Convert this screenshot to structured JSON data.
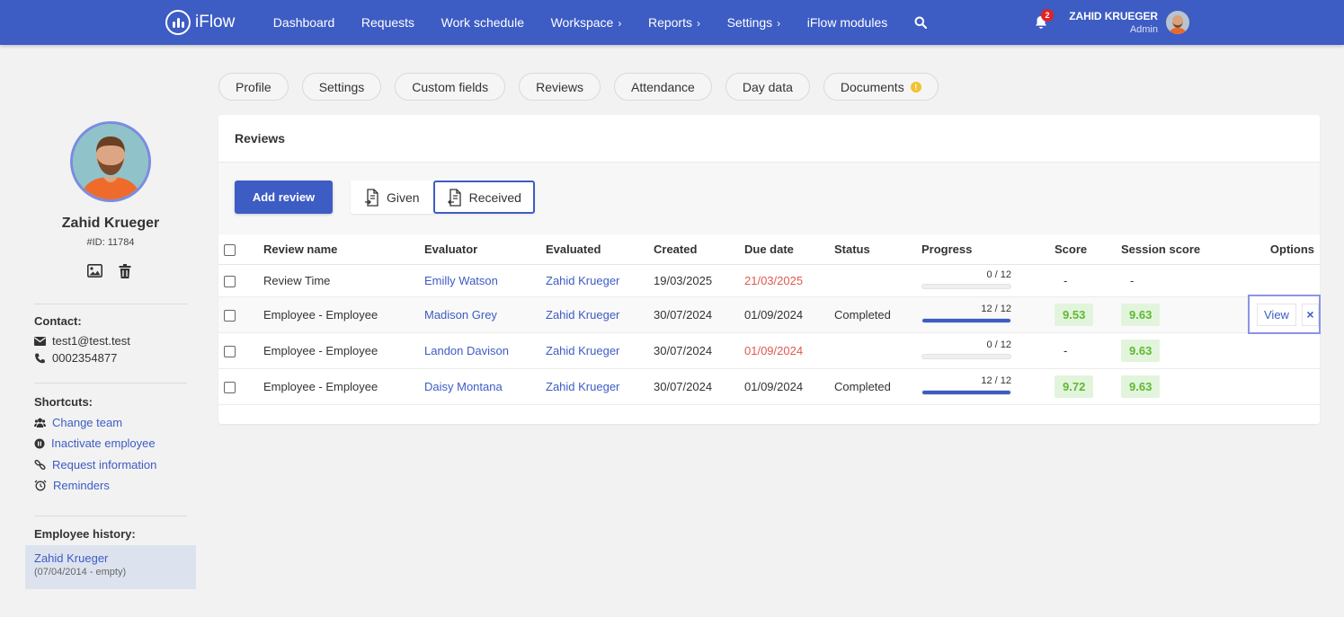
{
  "brand": {
    "name": "iFlow"
  },
  "nav": {
    "items": [
      {
        "label": "Dashboard",
        "has_submenu": false
      },
      {
        "label": "Requests",
        "has_submenu": false
      },
      {
        "label": "Work schedule",
        "has_submenu": false
      },
      {
        "label": "Workspace",
        "has_submenu": true
      },
      {
        "label": "Reports",
        "has_submenu": true
      },
      {
        "label": "Settings",
        "has_submenu": true
      },
      {
        "label": "iFlow modules",
        "has_submenu": false
      }
    ],
    "chevron": "›"
  },
  "user": {
    "name": "ZAHID KRUEGER",
    "role": "Admin",
    "notifications": "2"
  },
  "employee": {
    "name": "Zahid Krueger",
    "id": "#ID: 11784",
    "contact_title": "Contact:",
    "email": "test1@test.test",
    "phone": "0002354877",
    "shortcuts_title": "Shortcuts:",
    "shortcuts": [
      "Change team",
      "Inactivate employee",
      "Request information",
      "Reminders"
    ],
    "history_title": "Employee history:",
    "history": {
      "name": "Zahid Krueger",
      "range": "(07/04/2014 - empty)"
    }
  },
  "tabs": [
    {
      "label": "Profile",
      "warning": false
    },
    {
      "label": "Settings",
      "warning": false
    },
    {
      "label": "Custom fields",
      "warning": false
    },
    {
      "label": "Reviews",
      "warning": false
    },
    {
      "label": "Attendance",
      "warning": false
    },
    {
      "label": "Day data",
      "warning": false
    },
    {
      "label": "Documents",
      "warning": true
    }
  ],
  "reviews": {
    "title": "Reviews",
    "add_label": "Add review",
    "given_label": "Given",
    "received_label": "Received",
    "active_toggle": "Received",
    "columns": [
      "Review name",
      "Evaluator",
      "Evaluated",
      "Created",
      "Due date",
      "Status",
      "Progress",
      "Score",
      "Session score",
      "Options"
    ],
    "rows": [
      {
        "name": "Review Time",
        "evaluator": "Emilly Watson",
        "evaluated": "Zahid Krueger",
        "created": "19/03/2025",
        "due": "21/03/2025",
        "due_overdue": true,
        "status": "",
        "progress_label": "0 / 12",
        "progress": 0,
        "score": "-",
        "session_score": "-"
      },
      {
        "name": "Employee - Employee",
        "evaluator": "Madison Grey",
        "evaluated": "Zahid Krueger",
        "created": "30/07/2024",
        "due": "01/09/2024",
        "due_overdue": false,
        "status": "Completed",
        "progress_label": "12 / 12",
        "progress": 1,
        "score": "9.53",
        "session_score": "9.63"
      },
      {
        "name": "Employee - Employee",
        "evaluator": "Landon Davison",
        "evaluated": "Zahid Krueger",
        "created": "30/07/2024",
        "due": "01/09/2024",
        "due_overdue": true,
        "status": "",
        "progress_label": "0 / 12",
        "progress": 0,
        "score": "-",
        "session_score": "9.63"
      },
      {
        "name": "Employee - Employee",
        "evaluator": "Daisy Montana",
        "evaluated": "Zahid Krueger",
        "created": "30/07/2024",
        "due": "01/09/2024",
        "due_overdue": false,
        "status": "Completed",
        "progress_label": "12 / 12",
        "progress": 1,
        "score": "9.72",
        "session_score": "9.63"
      }
    ],
    "options": {
      "view_label": "View",
      "close_label": "×",
      "row_index": 1
    }
  },
  "colors": {
    "primary": "#3d5cc4",
    "overdue": "#e05a4e",
    "score_bg": "#e2f5dc",
    "score_text": "#5fb832",
    "focus": "#8b93e8"
  },
  "icons": {
    "search": "search-icon",
    "bell": "bell-icon",
    "image": "image-icon",
    "trash": "trash-icon",
    "mail": "envelope-icon",
    "phone": "phone-icon",
    "warning": "warning-icon"
  }
}
